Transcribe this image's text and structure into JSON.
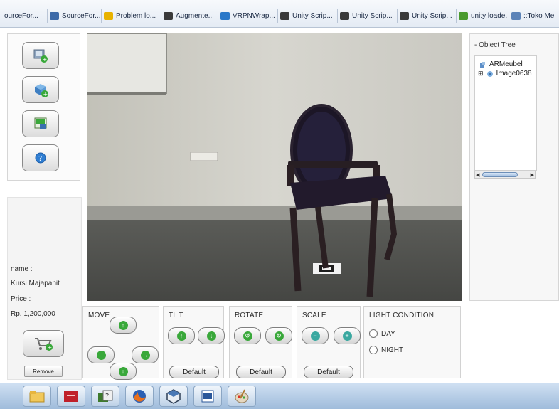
{
  "browser": {
    "bookmarks": [
      {
        "label": "ourceFor...",
        "icon": "page-icon",
        "color": "#e1e7ef"
      },
      {
        "label": "SourceFor...",
        "icon": "sourceforge-icon",
        "color": "#3d6aa8"
      },
      {
        "label": "Problem lo...",
        "icon": "warning-icon",
        "color": "#e8b200"
      },
      {
        "label": "Augmente...",
        "icon": "unity-icon",
        "color": "#3a3a3a"
      },
      {
        "label": "VRPNWrap...",
        "icon": "globe-icon",
        "color": "#2a78c9"
      },
      {
        "label": "Unity Scrip...",
        "icon": "unity-icon",
        "color": "#3a3a3a"
      },
      {
        "label": "Unity Scrip...",
        "icon": "unity-icon",
        "color": "#3a3a3a"
      },
      {
        "label": "Unity Scrip...",
        "icon": "unity-icon",
        "color": "#3a3a3a"
      },
      {
        "label": "unity loade...",
        "icon": "puzzle-icon",
        "color": "#4a9a2e"
      },
      {
        "label": "::Toko Me",
        "icon": "image-icon",
        "color": "#5b83b8"
      }
    ]
  },
  "tools": [
    {
      "name": "add-model-icon"
    },
    {
      "name": "add-object-icon"
    },
    {
      "name": "save-scene-icon"
    },
    {
      "name": "help-icon"
    }
  ],
  "info": {
    "name_label": "name :",
    "name_value": "Kursi Majapahit",
    "price_label": "Price :",
    "price_value": "Rp. 1,200,000",
    "remove_label": "Remove"
  },
  "object_tree": {
    "title": "- Object Tree",
    "root": "ARMeubel",
    "child": "Image0638",
    "expander": "⊞"
  },
  "controls": {
    "move": {
      "title": "MOVE"
    },
    "tilt": {
      "title": "TILT",
      "default_label": "Default"
    },
    "rotate": {
      "title": "ROTATE",
      "default_label": "Default"
    },
    "scale": {
      "title": "SCALE",
      "default_label": "Default"
    },
    "light": {
      "title": "LIGHT CONDITION",
      "option_day": "DAY",
      "option_night": "NIGHT"
    }
  },
  "taskbar": {
    "apps": [
      "explorer-icon",
      "presentation-icon",
      "help-app-icon",
      "firefox-icon",
      "unity-app-icon",
      "word-icon",
      "paint-icon"
    ]
  },
  "colors": {
    "accent_green": "#39a83a",
    "accent_blue": "#2f7dd1",
    "accent_teal": "#3aa8a0"
  }
}
